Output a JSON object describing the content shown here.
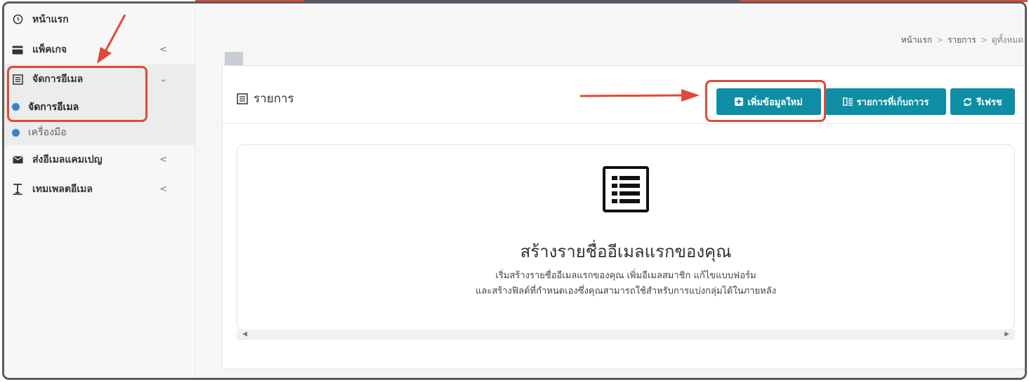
{
  "sidebar": {
    "items": [
      {
        "label": "หน้าแรก",
        "icon": "clock-icon"
      },
      {
        "label": "แพ็คเกจ",
        "icon": "credit-card-icon",
        "caret": "<"
      },
      {
        "label": "จัดการอีเมล",
        "icon": "list-box-icon",
        "caret": "⌄"
      },
      {
        "label": "ส่งอีเมลแคมเปญ",
        "icon": "envelope-icon",
        "caret": "<"
      },
      {
        "label": "เทมเพลตอีเมล",
        "icon": "text-t-icon",
        "caret": "<"
      }
    ],
    "sub_items": [
      {
        "label": "จัดการอีเมล",
        "active": true
      },
      {
        "label": "เครื่องมือ",
        "active": false
      }
    ]
  },
  "breadcrumb": {
    "home": "หน้าแรก",
    "list": "รายการ",
    "current": "ดูทั้งหมด",
    "separator": ">"
  },
  "panel": {
    "title": "รายการ",
    "buttons": {
      "add_new": "เพิ่มข้อมูลใหม่",
      "archived": "รายการที่เก็บถาวร",
      "refresh": "รีเฟรช"
    }
  },
  "empty_state": {
    "title": "สร้างรายชื่ออีเมลแรกของคุณ",
    "line1": "เริ่มสร้างรายชื่ออีเมลแรกของคุณ เพิ่มอีเมลสมาชิก แก้ไขแบบฟอร์ม",
    "line2": "และสร้างฟิลด์ที่กำหนดเองซึ่งคุณสามารถใช้สำหรับการแบ่งกลุ่มได้ในภายหลัง"
  },
  "colors": {
    "accent": "#0e8ea4",
    "highlight": "#e04a35",
    "active_dot": "#2f86d6"
  }
}
